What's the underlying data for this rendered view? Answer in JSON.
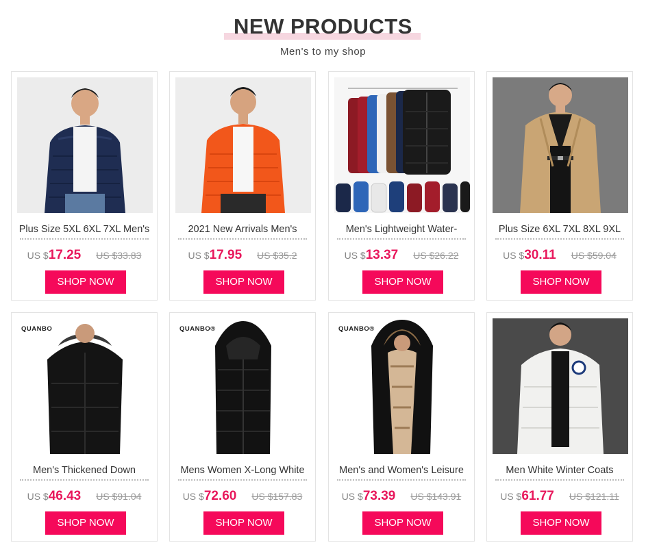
{
  "header": {
    "title": "NEW PRODUCTS",
    "subtitle": "Men's to my shop"
  },
  "products": [
    {
      "name": "Plus Size 5XL 6XL 7XL Men's",
      "currency": "US $",
      "price": "17.25",
      "old_price": "US $33.83",
      "button": "SHOP NOW"
    },
    {
      "name": "2021 New Arrivals Men's",
      "currency": "US $",
      "price": "17.95",
      "old_price": "US $35.2",
      "button": "SHOP NOW"
    },
    {
      "name": "Men's Lightweight Water-",
      "currency": "US $",
      "price": "13.37",
      "old_price": "US $26.22",
      "button": "SHOP NOW"
    },
    {
      "name": "Plus Size 6XL 7XL 8XL 9XL",
      "currency": "US $",
      "price": "30.11",
      "old_price": "US $59.04",
      "button": "SHOP NOW"
    },
    {
      "name": "Men's Thickened Down",
      "currency": "US $",
      "price": "46.43",
      "old_price": "US $91.04",
      "button": "SHOP NOW",
      "brand": "QUANBO"
    },
    {
      "name": "Mens Women X-Long White",
      "currency": "US $",
      "price": "72.60",
      "old_price": "US $157.83",
      "button": "SHOP NOW",
      "brand": "QUANBO®"
    },
    {
      "name": "Men's and Women's Leisure",
      "currency": "US $",
      "price": "73.39",
      "old_price": "US $143.91",
      "button": "SHOP NOW",
      "brand": "QUANBO®"
    },
    {
      "name": "Men White Winter Coats",
      "currency": "US $",
      "price": "61.77",
      "old_price": "US $121.11",
      "button": "SHOP NOW"
    }
  ],
  "colors": {
    "accent": "#f5095a",
    "price": "#e8185c",
    "title_highlight": "#f6d7e0"
  }
}
